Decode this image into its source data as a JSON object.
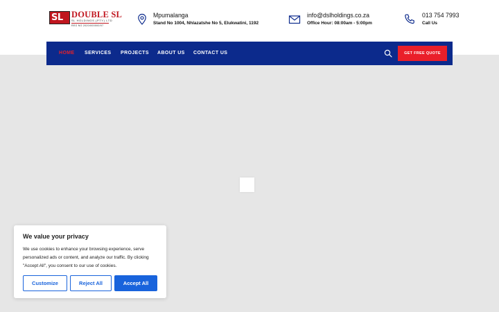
{
  "header": {
    "logo": {
      "box_text": "SL",
      "name": "DOUBLE SL",
      "tagline": "SL HOLDINGS (PTY) LTD",
      "tagline2": "REG NO 2020/000000/07"
    },
    "location": {
      "icon": "map-pin-icon",
      "title": "Mpumalanga",
      "subtitle": "Stand No 1004, Nhlazatshe No 5, Elukwatini, 1192"
    },
    "email": {
      "icon": "envelope-icon",
      "title": "info@dslholdings.co.za",
      "subtitle": "Office Hour: 08:00am - 5:00pm"
    },
    "phone": {
      "icon": "phone-icon",
      "title": "013 754 7993",
      "subtitle": "Call Us"
    }
  },
  "nav": {
    "items": [
      {
        "label": "HOME",
        "active": true
      },
      {
        "label": "SERVICES",
        "active": false
      },
      {
        "label": "PROJECTS",
        "active": false
      },
      {
        "label": "ABOUT US",
        "active": false
      },
      {
        "label": "CONTACT US",
        "active": false
      }
    ],
    "search_icon": "search-icon",
    "quote_label": "GET FREE QUOTE"
  },
  "cookie_banner": {
    "title": "We value your privacy",
    "body": "We use cookies to enhance your browsing experience, serve personalized ads or content, and analyze our traffic. By clicking \"Accept All\", you consent to our use of cookies.",
    "customize_label": "Customize",
    "reject_label": "Reject All",
    "accept_label": "Accept All"
  },
  "colors": {
    "nav_bg": "#0c2a8c",
    "accent_red": "#ea1f2a",
    "cookie_blue": "#1863dc",
    "page_bg": "#e6e6e6"
  }
}
